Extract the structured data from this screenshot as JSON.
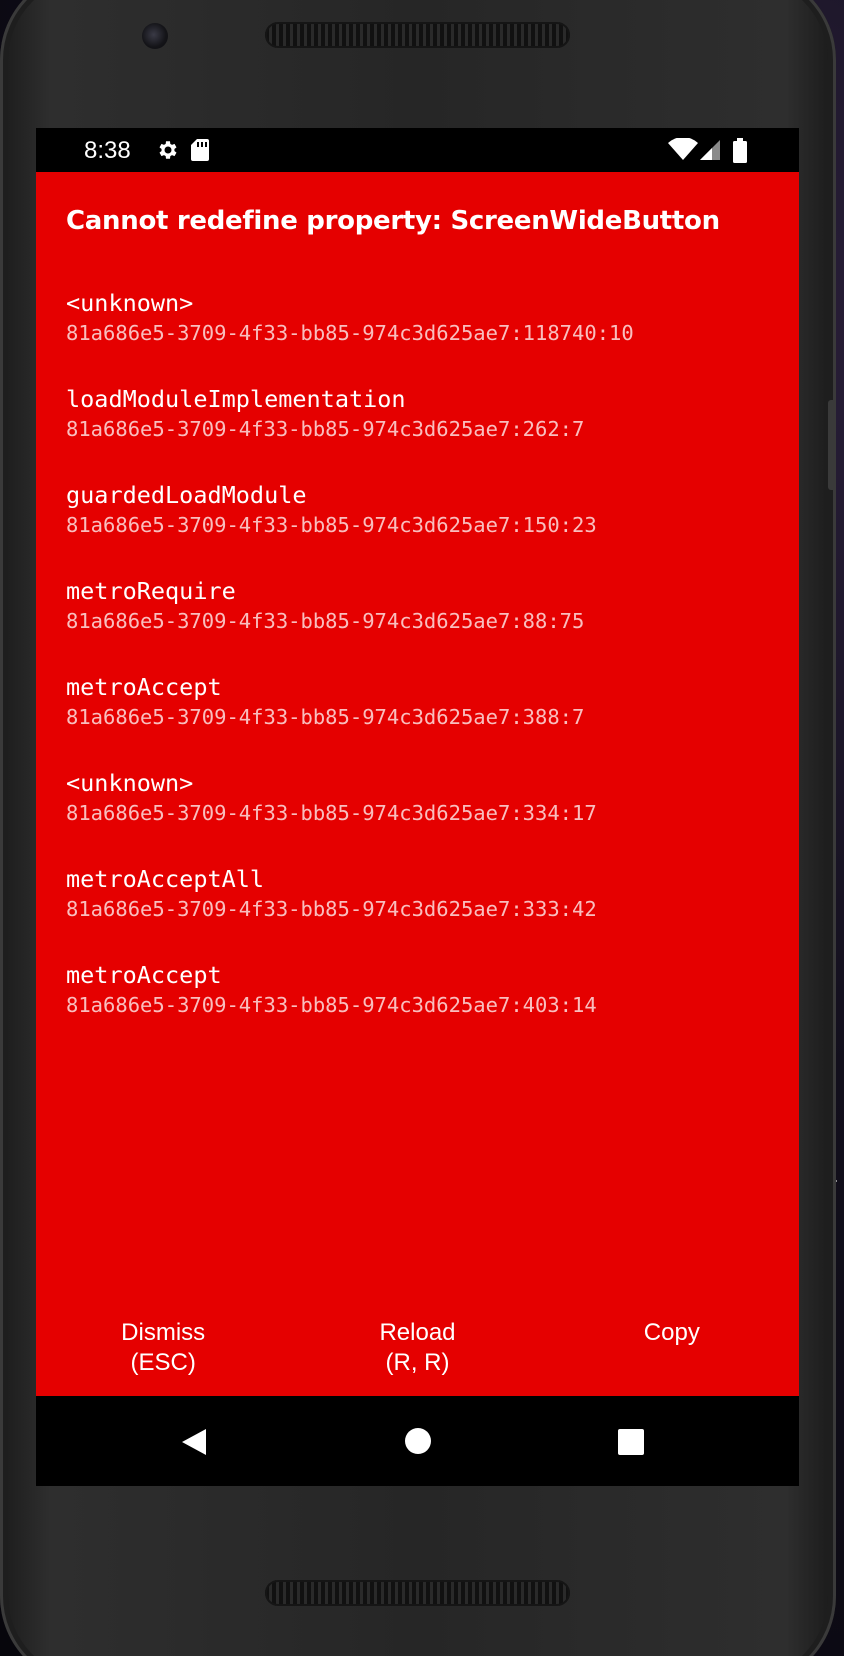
{
  "status_bar": {
    "time": "8:38",
    "icons": [
      "settings-icon",
      "sd-card-icon",
      "wifi-icon",
      "cellular-signal-icon",
      "battery-icon"
    ]
  },
  "error": {
    "title": "Cannot redefine property: ScreenWideButton"
  },
  "stack_frames": [
    {
      "method": "<unknown>",
      "location": "81a686e5-3709-4f33-bb85-974c3d625ae7:118740:10"
    },
    {
      "method": "loadModuleImplementation",
      "location": "81a686e5-3709-4f33-bb85-974c3d625ae7:262:7"
    },
    {
      "method": "guardedLoadModule",
      "location": "81a686e5-3709-4f33-bb85-974c3d625ae7:150:23"
    },
    {
      "method": "metroRequire",
      "location": "81a686e5-3709-4f33-bb85-974c3d625ae7:88:75"
    },
    {
      "method": "metroAccept",
      "location": "81a686e5-3709-4f33-bb85-974c3d625ae7:388:7"
    },
    {
      "method": "<unknown>",
      "location": "81a686e5-3709-4f33-bb85-974c3d625ae7:334:17"
    },
    {
      "method": "metroAcceptAll",
      "location": "81a686e5-3709-4f33-bb85-974c3d625ae7:333:42"
    },
    {
      "method": "metroAccept",
      "location": "81a686e5-3709-4f33-bb85-974c3d625ae7:403:14"
    }
  ],
  "actions": {
    "dismiss": {
      "label": "Dismiss",
      "shortcut": "(ESC)"
    },
    "reload": {
      "label": "Reload",
      "shortcut": "(R, R)"
    },
    "copy": {
      "label": "Copy"
    }
  },
  "nav_bar": {
    "icons": [
      "back-icon",
      "home-icon",
      "recents-icon"
    ]
  },
  "colors": {
    "redbox_background": "#e50000",
    "bar_background": "#000000",
    "text": "#ffffff"
  }
}
